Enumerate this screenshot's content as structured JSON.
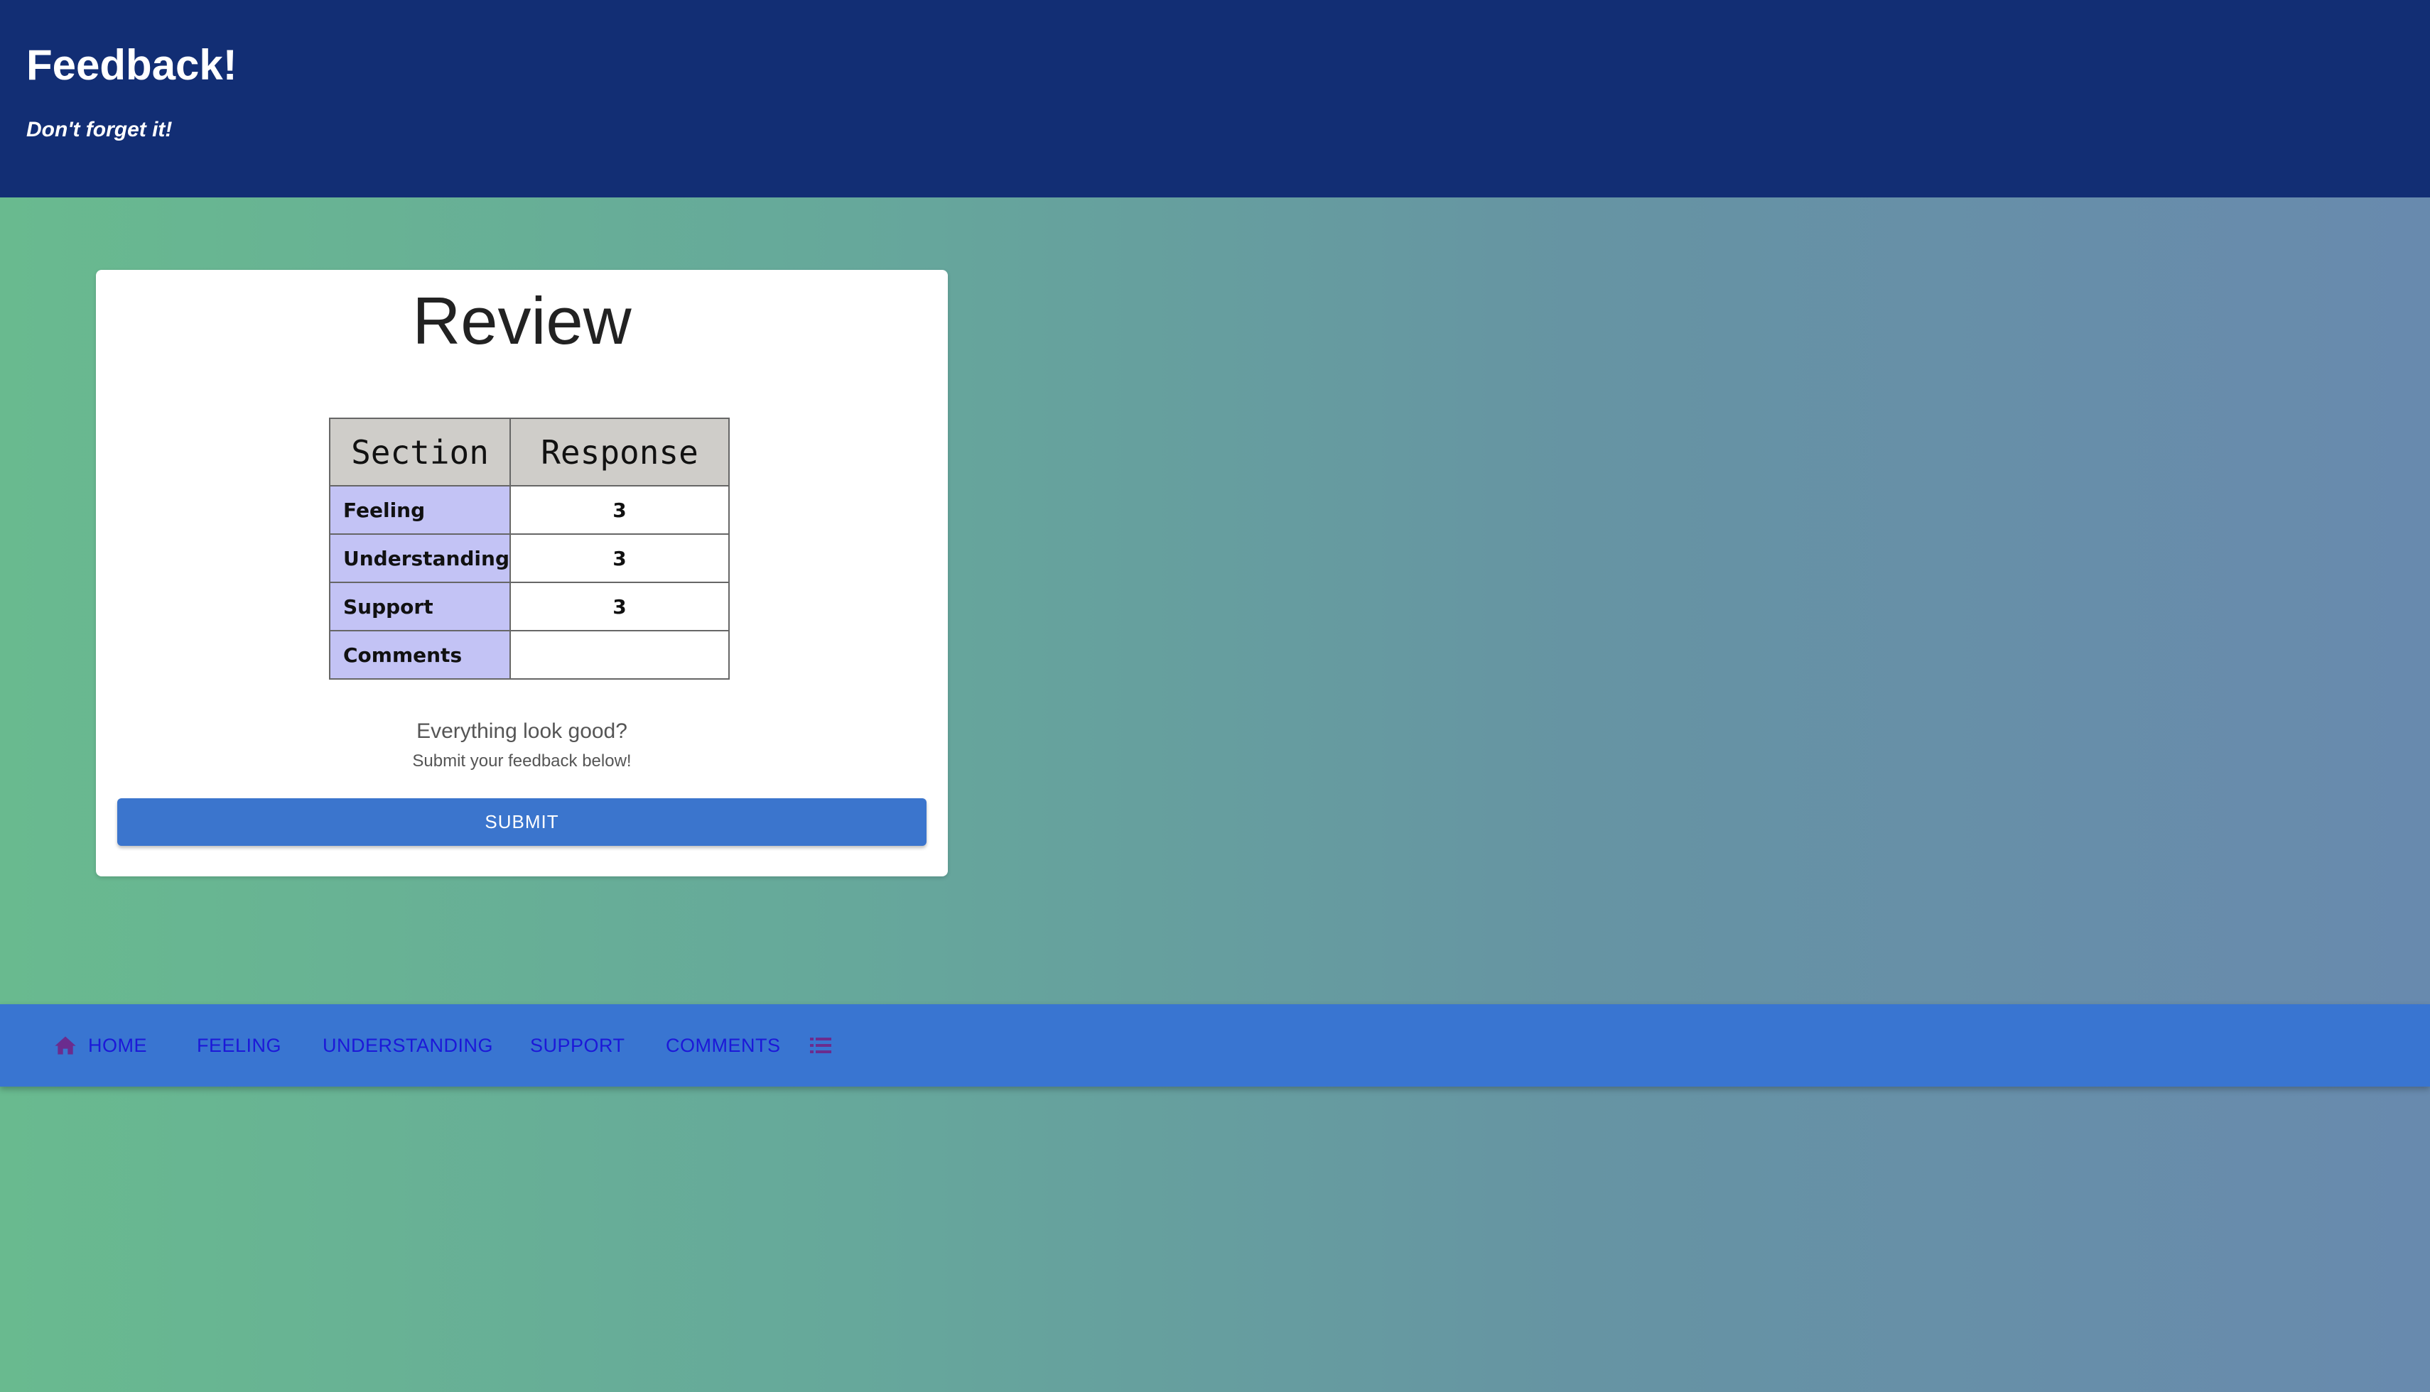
{
  "header": {
    "title": "Feedback!",
    "subtitle": "Don't forget it!"
  },
  "review": {
    "title": "Review",
    "table": {
      "headers": [
        "Section",
        "Response"
      ],
      "rows": [
        {
          "section": "Feeling",
          "response": "3"
        },
        {
          "section": "Understanding",
          "response": "3"
        },
        {
          "section": "Support",
          "response": "3"
        },
        {
          "section": "Comments",
          "response": ""
        }
      ]
    },
    "confirm_question": "Everything look good?",
    "confirm_note": "Submit your feedback below!",
    "submit_label": "SUBMIT"
  },
  "nav": {
    "items": [
      {
        "label": "HOME",
        "icon": "home-icon"
      },
      {
        "label": "FEELING"
      },
      {
        "label": "UNDERSTANDING"
      },
      {
        "label": "SUPPORT"
      },
      {
        "label": "COMMENTS"
      },
      {
        "label": "",
        "icon": "list-icon"
      }
    ]
  },
  "colors": {
    "header_bg": "#122e74",
    "nav_bg": "#3975d1",
    "nav_text": "#1c18d8",
    "button_bg": "#3b75cd",
    "section_cell_bg": "#c3c3f5",
    "table_header_bg": "#cfcdc9",
    "icon_color": "#6b2c8e"
  }
}
